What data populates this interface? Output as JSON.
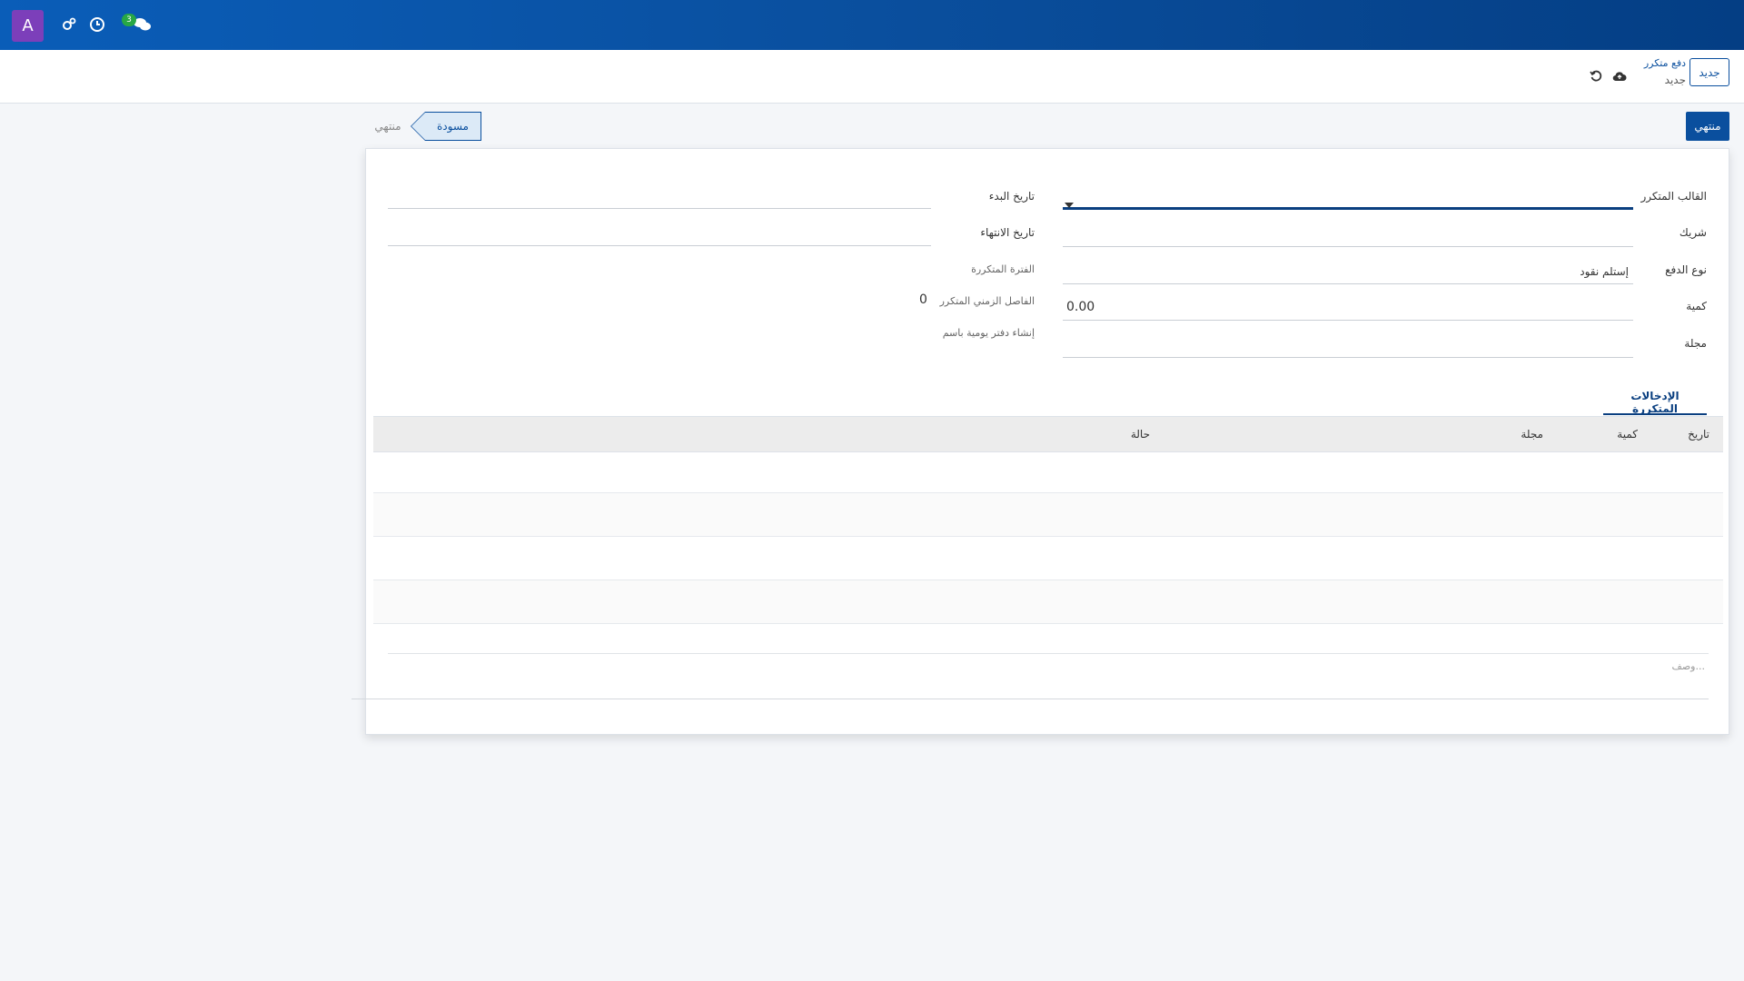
{
  "topbar": {
    "avatar_letter": "A",
    "messages_count": "3",
    "icons": [
      "settings-icon",
      "clock-icon",
      "chat-icon"
    ],
    "accent": "#0a4f9e"
  },
  "controlbar": {
    "new_label": "جديد",
    "breadcrumb_parent": "دفع متكرر",
    "breadcrumb_current": "جديد",
    "icons": [
      "save-cloud-icon",
      "discard-icon"
    ]
  },
  "actions": {
    "posted_button": "منتهي"
  },
  "statusbar": {
    "draft": "مسودة",
    "posted": "منتهي"
  },
  "form": {
    "left": {
      "template_label": "القالب المتكرر",
      "partner_label": "شريك",
      "payment_type_label": "نوع الدفع",
      "payment_type_value": "إستلم نقود",
      "amount_label": "كمية",
      "amount_value": "0.00",
      "journal_label": "مجلة"
    },
    "right": {
      "start_date_label": "تاريخ البدء",
      "end_date_label": "تاريخ الانتهاء",
      "recurring_period_label": "الفترة المتكررة",
      "recurring_interval_label": "الفاصل الزمني المتكرر",
      "recurring_interval_value": "0",
      "journal_create_label": "إنشاء دفتر يومية باسم"
    }
  },
  "tabs": {
    "entries_tab": "الإدخالات المتكررة"
  },
  "table": {
    "headers": [
      "تاريخ",
      "كمية",
      "مجلة",
      "حالة"
    ]
  },
  "description_placeholder": "وصف..."
}
